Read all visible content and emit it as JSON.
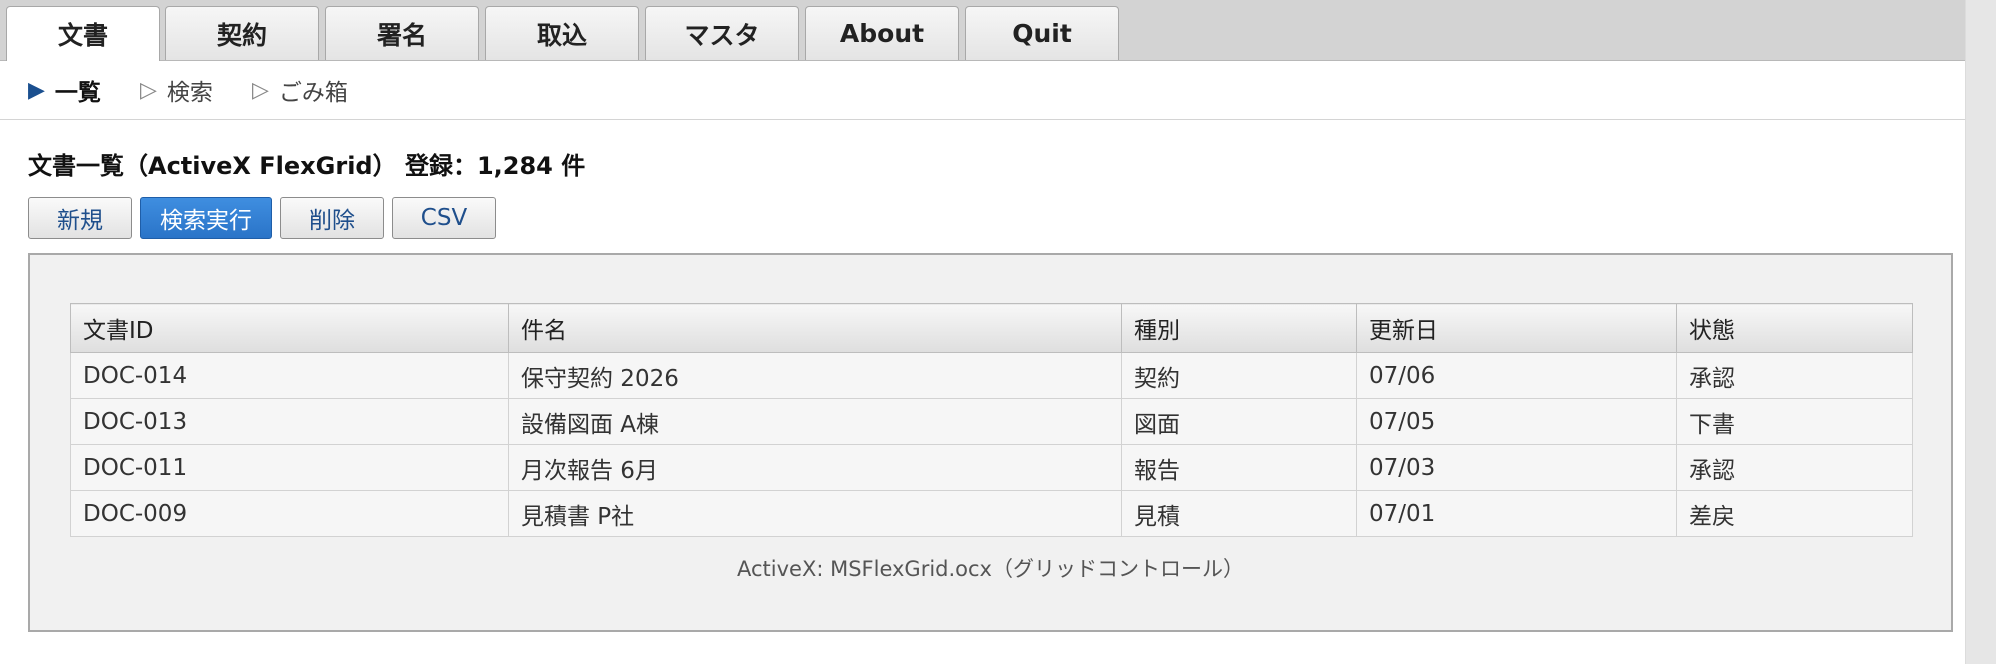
{
  "tabs": [
    {
      "label": "文書",
      "active": true
    },
    {
      "label": "契約",
      "active": false
    },
    {
      "label": "署名",
      "active": false
    },
    {
      "label": "取込",
      "active": false
    },
    {
      "label": "マスタ",
      "active": false
    },
    {
      "label": "About",
      "active": false
    },
    {
      "label": "Quit",
      "active": false
    }
  ],
  "subnav": [
    {
      "icon": "▶",
      "label": "一覧",
      "current": true
    },
    {
      "icon": "▷",
      "label": "検索",
      "current": false
    },
    {
      "icon": "▷",
      "label": "ごみ箱",
      "current": false
    }
  ],
  "page": {
    "title": "文書一覧（ActiveX FlexGrid） 登録：1,284 件"
  },
  "toolbar": {
    "new_label": "新規",
    "search_label": "検索実行",
    "delete_label": "削除",
    "csv_label": "CSV"
  },
  "grid": {
    "columns": [
      "文書ID",
      "件名",
      "種別",
      "更新日",
      "状態"
    ],
    "rows": [
      [
        "DOC-014",
        "保守契約 2026",
        "契約",
        "07/06",
        "承認"
      ],
      [
        "DOC-013",
        "設備図面 A棟",
        "図面",
        "07/05",
        "下書"
      ],
      [
        "DOC-011",
        "月次報告 6月",
        "報告",
        "07/03",
        "承認"
      ],
      [
        "DOC-009",
        "見積書 P社",
        "見積",
        "07/01",
        "差戻"
      ]
    ],
    "caption": "ActiveX: MSFlexGrid.ocx（グリッドコントロール）"
  },
  "colors": {
    "primary": "#2a74c8",
    "accent_text": "#1f4f8c",
    "tab_bar": "#d3d3d3"
  }
}
